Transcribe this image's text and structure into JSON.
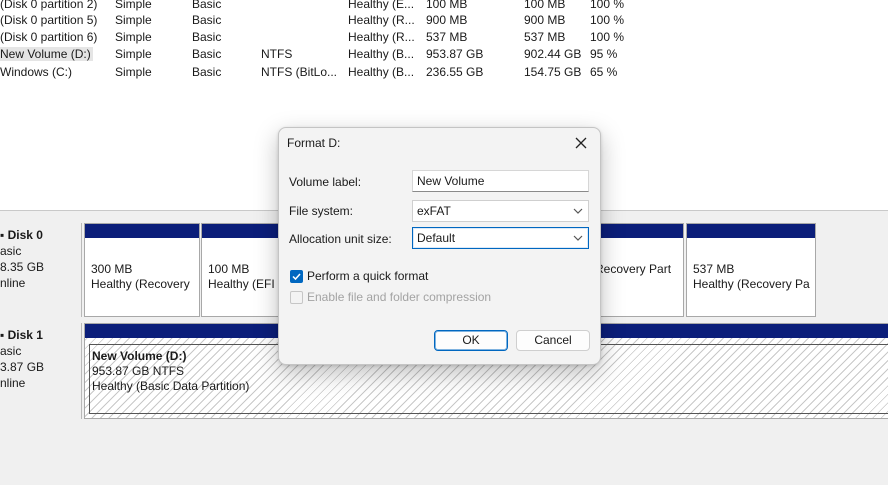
{
  "volumes": [
    {
      "name": "(Disk 0 partition 2)",
      "layout": "Simple",
      "type": "Basic",
      "fs": "",
      "status": "Healthy (E...",
      "capacity": "100 MB",
      "free": "100 MB",
      "pct": "100 %"
    },
    {
      "name": "(Disk 0 partition 5)",
      "layout": "Simple",
      "type": "Basic",
      "fs": "",
      "status": "Healthy (R...",
      "capacity": "900 MB",
      "free": "900 MB",
      "pct": "100 %"
    },
    {
      "name": "(Disk 0 partition 6)",
      "layout": "Simple",
      "type": "Basic",
      "fs": "",
      "status": "Healthy (R...",
      "capacity": "537 MB",
      "free": "537 MB",
      "pct": "100 %"
    },
    {
      "name": "New Volume (D:)",
      "layout": "Simple",
      "type": "Basic",
      "fs": "NTFS",
      "status": "Healthy (B...",
      "capacity": "953.87 GB",
      "free": "902.44 GB",
      "pct": "95 %"
    },
    {
      "name": "Windows (C:)",
      "layout": "Simple",
      "type": "Basic",
      "fs": "NTFS (BitLo...",
      "status": "Healthy (B...",
      "capacity": "236.55 GB",
      "free": "154.75 GB",
      "pct": "65 %"
    }
  ],
  "disks": [
    {
      "name": "Disk 0",
      "type": "asic",
      "size": "8.35 GB",
      "state": "nline",
      "partitions": [
        {
          "size": "300 MB",
          "status": "Healthy (Recovery"
        },
        {
          "size": "100 MB",
          "status": "Healthy (EFI S"
        },
        {
          "size": "",
          "status": "Recovery Part"
        },
        {
          "size": "537 MB",
          "status": "Healthy (Recovery Pa"
        }
      ]
    },
    {
      "name": "Disk 1",
      "type": "asic",
      "size": "3.87 GB",
      "state": "nline",
      "partitions": [
        {
          "name": "New Volume  (D:)",
          "size": "953.87 GB NTFS",
          "status": "Healthy (Basic Data Partition)"
        }
      ]
    }
  ],
  "dialog": {
    "title": "Format D:",
    "volume_label_caption": "Volume label:",
    "volume_label_value": "New Volume",
    "file_system_caption": "File system:",
    "file_system_value": "exFAT",
    "alloc_caption": "Allocation unit size:",
    "alloc_value": "Default",
    "quick_format_label": "Perform a quick format",
    "quick_format_checked": true,
    "compression_label": "Enable file and folder compression",
    "compression_checked": false,
    "ok_label": "OK",
    "cancel_label": "Cancel"
  },
  "colors": {
    "partition_bar": "#0b1e7a",
    "accent": "#0067c0"
  }
}
